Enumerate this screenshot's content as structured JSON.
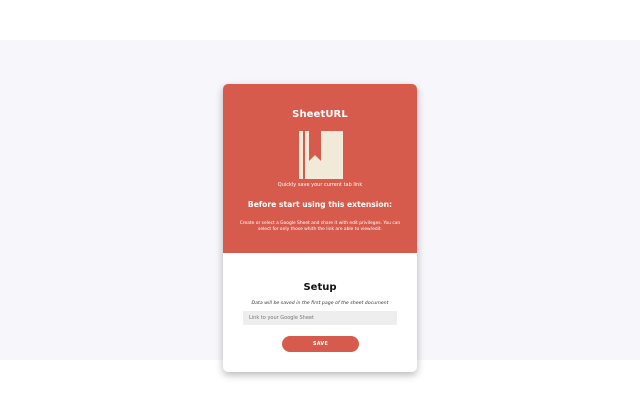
{
  "app": {
    "title": "SheetURL",
    "tagline": "Quickly save your current tab link"
  },
  "intro": {
    "heading": "Before start using this extension:",
    "instructions": "Create or select a Google Sheet and share it with edit privileges. You can select for only those whith the link are able to view/edit."
  },
  "setup": {
    "title": "Setup",
    "note": "Data will be saved in the first page of the sheet document",
    "input_value": "",
    "input_placeholder": "Link to your Google Sheet",
    "save_label": "SAVE"
  },
  "colors": {
    "brand": "#d65b4c",
    "icon_fill": "#f1ead8",
    "background": "#f6f6fb"
  },
  "icons": {
    "logo": "bookmark-book-icon"
  }
}
